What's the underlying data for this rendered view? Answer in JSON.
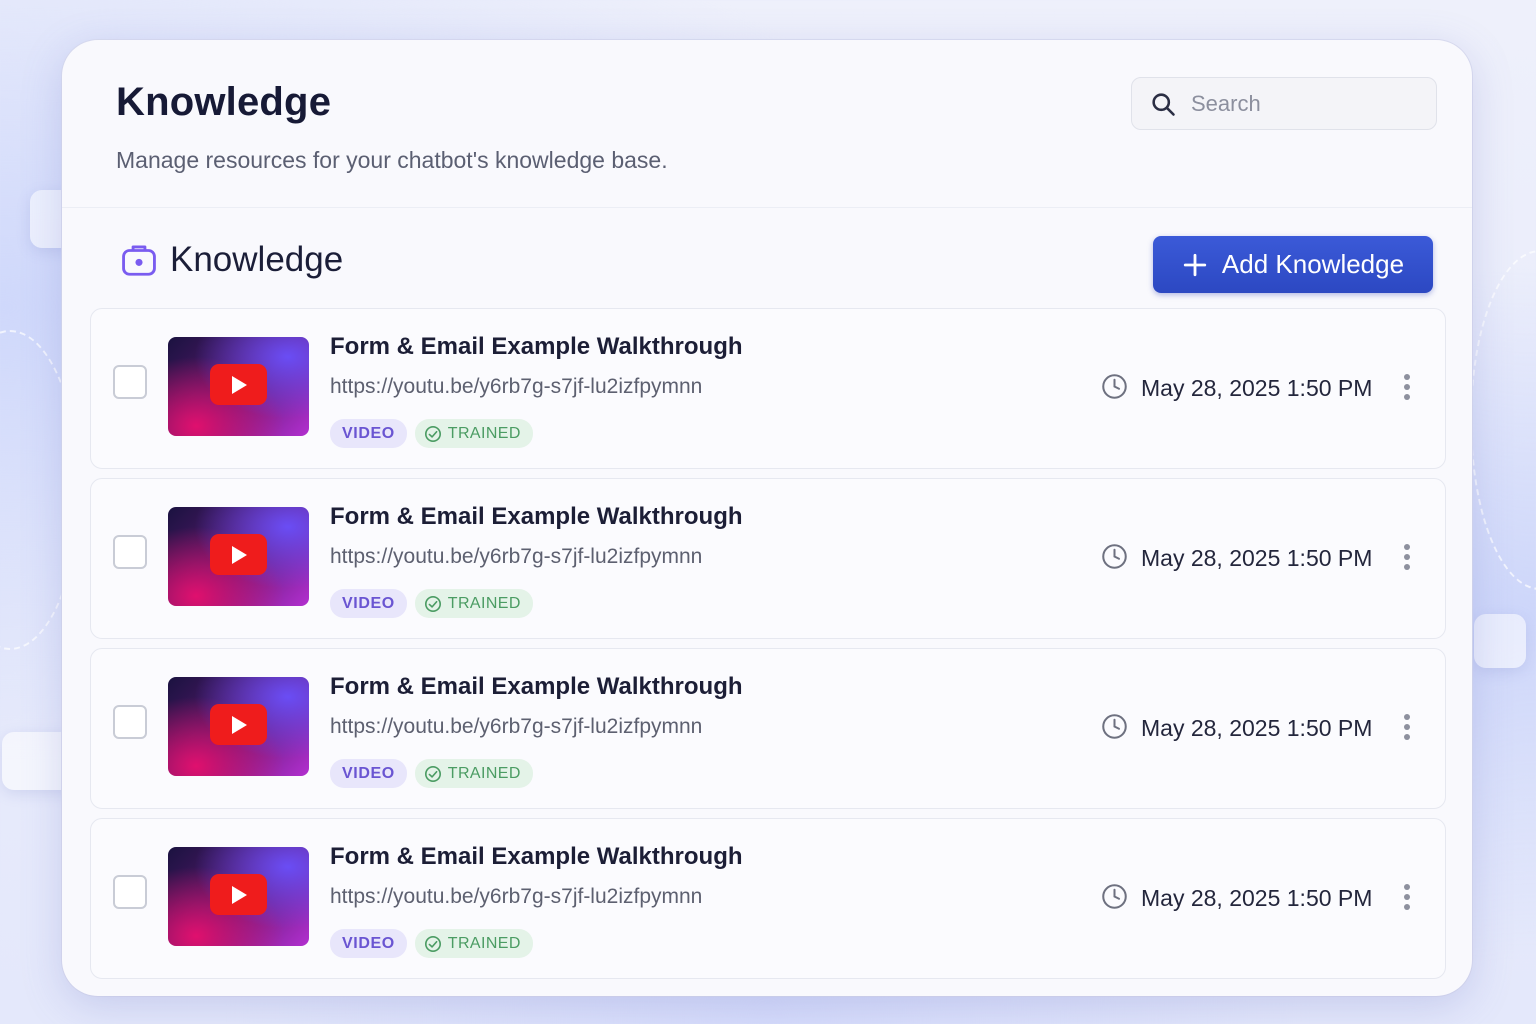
{
  "header": {
    "title": "Knowledge",
    "subtitle": "Manage resources for your chatbot's knowledge base.",
    "search_placeholder": "Search"
  },
  "section": {
    "title": "Knowledge",
    "add_button_label": "Add Knowledge"
  },
  "items": [
    {
      "title": "Form & Email Example Walkthrough",
      "url": "https://youtu.be/y6rb7g-s7jf-lu2izfpymnn",
      "type_tag": "VIDEO",
      "status_tag": "TRAINED",
      "date": "May 28, 2025 1:50 PM"
    },
    {
      "title": "Form & Email Example Walkthrough",
      "url": "https://youtu.be/y6rb7g-s7jf-lu2izfpymnn",
      "type_tag": "VIDEO",
      "status_tag": "TRAINED",
      "date": "May 28, 2025 1:50 PM"
    },
    {
      "title": "Form & Email Example Walkthrough",
      "url": "https://youtu.be/y6rb7g-s7jf-lu2izfpymnn",
      "type_tag": "VIDEO",
      "status_tag": "TRAINED",
      "date": "May 28, 2025 1:50 PM"
    },
    {
      "title": "Form & Email Example Walkthrough",
      "url": "https://youtu.be/y6rb7g-s7jf-lu2izfpymnn",
      "type_tag": "VIDEO",
      "status_tag": "TRAINED",
      "date": "May 28, 2025 1:50 PM"
    }
  ],
  "icons": {
    "search": "search-icon",
    "section": "knowledge-box-icon",
    "add": "plus-icon",
    "thumbnail": "youtube-play-icon",
    "trained": "check-circle-icon",
    "time": "clock-icon",
    "menu": "more-vertical-icon"
  },
  "colors": {
    "primary_button": "#2f4cc8",
    "video_tag_bg": "#e8e6fb",
    "video_tag_text": "#6a55d2",
    "trained_tag_bg": "#e4f3e8",
    "trained_tag_text": "#4b9c63",
    "play_button": "#ef1c1c"
  }
}
